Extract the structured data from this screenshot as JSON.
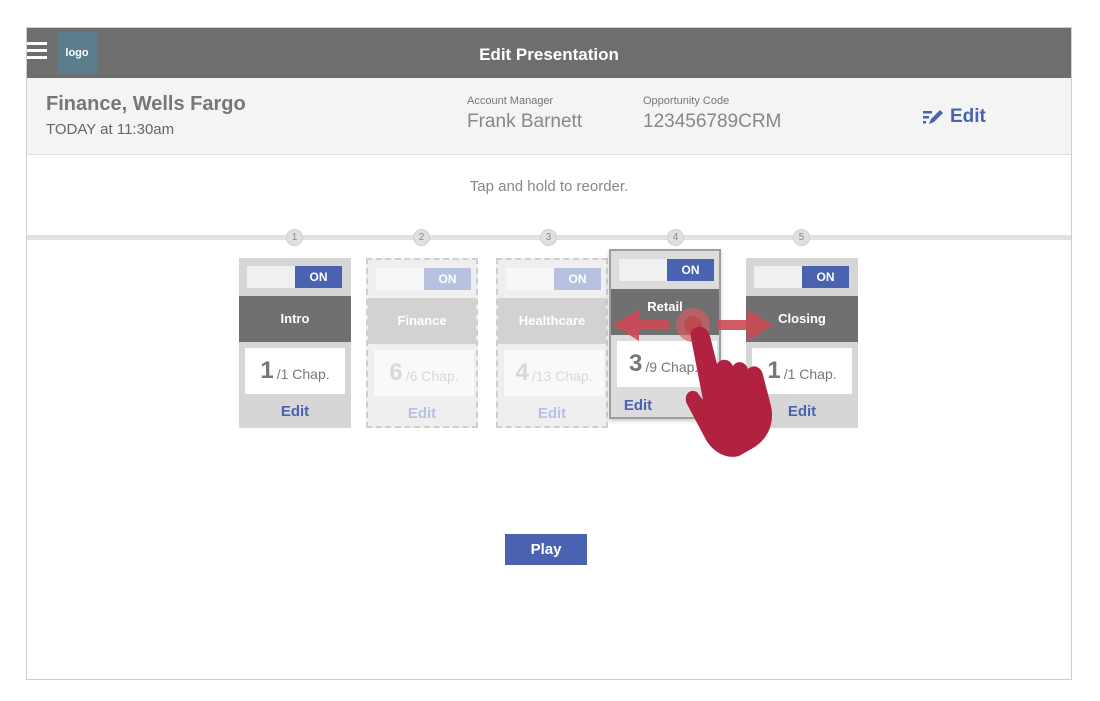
{
  "header": {
    "logo_text": "logo",
    "title": "Edit Presentation"
  },
  "info": {
    "client_name": "Finance, Wells Fargo",
    "client_time": "TODAY at 11:30am",
    "account_manager_label": "Account Manager",
    "account_manager_value": "Frank Barnett",
    "opportunity_label": "Opportunity Code",
    "opportunity_value": "123456789CRM",
    "edit_label": "Edit"
  },
  "hint": "Tap and hold to reorder.",
  "steps": [
    "1",
    "2",
    "3",
    "4",
    "5"
  ],
  "cards": [
    {
      "toggle": "ON",
      "name": "Intro",
      "chapters": "1",
      "total": "/1 Chap.",
      "edit": "Edit",
      "state": "normal"
    },
    {
      "toggle": "ON",
      "name": "Finance",
      "chapters": "6",
      "total": "/6 Chap.",
      "edit": "Edit",
      "state": "faded"
    },
    {
      "toggle": "ON",
      "name": "Healthcare",
      "chapters": "4",
      "total": "/13 Chap.",
      "edit": "Edit",
      "state": "faded"
    },
    {
      "toggle": "ON",
      "name": "Retail",
      "chapters": "3",
      "total": "/9 Chap.",
      "edit": "Edit",
      "state": "dragging"
    },
    {
      "toggle": "ON",
      "name": "Closing",
      "chapters": "1",
      "total": "/1 Chap.",
      "edit": "Edit",
      "state": "normal"
    }
  ],
  "play_label": "Play",
  "colors": {
    "accent": "#4a63b0",
    "topbar": "#6e6e6e",
    "gesture": "#b0223f",
    "arrow": "#cc4a55"
  },
  "icons": {
    "menu": "hamburger-icon",
    "edit": "edit-pencil-icon",
    "gesture": "drag-hand-icon"
  }
}
